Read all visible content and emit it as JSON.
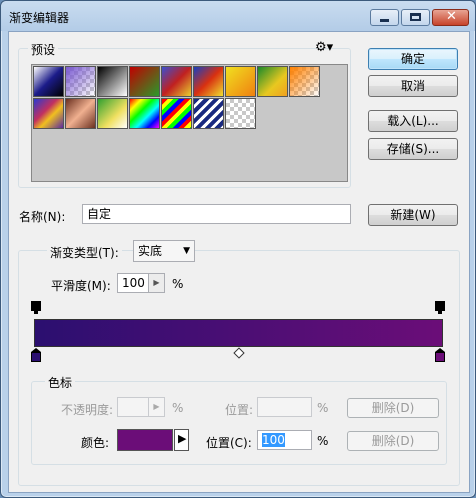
{
  "window": {
    "title": "渐变编辑器"
  },
  "presets": {
    "label": "预设",
    "menu_icon": "gear-icon",
    "swatches": [
      {
        "bg": "linear-gradient(135deg,#ffffff,#1c1c8a 50%,#000000)",
        "checker": false
      },
      {
        "bg": "linear-gradient(135deg,#7a5ad0,rgba(122,90,208,0))",
        "checker": true
      },
      {
        "bg": "linear-gradient(135deg,#000,#fff)",
        "checker": false
      },
      {
        "bg": "linear-gradient(135deg,#c00000,#2a9a2a)",
        "checker": false
      },
      {
        "bg": "linear-gradient(135deg,#3a50d0,#c02020 50%,#e8d030)",
        "checker": false
      },
      {
        "bg": "linear-gradient(135deg,#1840c0,#d83010 50%,#f0e030)",
        "checker": false
      },
      {
        "bg": "linear-gradient(135deg,#f0e020,#f08010)",
        "checker": false
      },
      {
        "bg": "linear-gradient(135deg,#1a8a2a,#e8c820 60%,#f0a020)",
        "checker": false
      },
      {
        "bg": "linear-gradient(135deg,#ff8000,rgba(255,128,0,0))",
        "checker": true
      },
      {
        "bg": "linear-gradient(135deg,#2a3ad0,#c23060 40%,#f0c020 60%,#5a2aa0)",
        "checker": false
      },
      {
        "bg": "linear-gradient(135deg,#6a3020,#f0b090 50%,#6a3020)",
        "checker": false
      },
      {
        "bg": "linear-gradient(135deg,#30a030,#f0e060 60%,#ffffff)",
        "checker": false
      },
      {
        "bg": "linear-gradient(135deg,#ff0000,#ffff00 20%,#00ff00 40%,#00ffff 60%,#0000ff 80%,#ff00ff)",
        "checker": false
      },
      {
        "bg": "repeating-linear-gradient(135deg,#ff0000 0 4px,#ffff00 4px 8px,#00ff00 8px 12px,#0000ff 12px 16px)",
        "checker": false
      },
      {
        "bg": "repeating-linear-gradient(135deg,#1a2a80 0 4px,#ffffff 4px 7px)",
        "checker": false
      },
      {
        "bg": "transparent",
        "checker": true
      }
    ]
  },
  "buttons": {
    "ok": "确定",
    "cancel": "取消",
    "load": "载入(L)...",
    "save": "存储(S)...",
    "new": "新建(W)"
  },
  "name": {
    "label": "名称(N):",
    "value": "自定"
  },
  "gradient_type": {
    "label": "渐变类型(T):",
    "value": "实底"
  },
  "smoothness": {
    "label": "平滑度(M):",
    "value": "100",
    "unit": "%"
  },
  "gradient": {
    "color_start": "#2b0f70",
    "color_end": "#6b0d78"
  },
  "color_stops": {
    "label": "色标",
    "opacity_label": "不透明度:",
    "opacity_unit": "%",
    "opacity_location_label": "位置:",
    "opacity_location_unit": "%",
    "opacity_delete": "删除(D)",
    "color_label": "颜色:",
    "color_value": "#6b0d78",
    "location_label": "位置(C):",
    "location_value": "100",
    "location_unit": "%",
    "color_delete": "删除(D)"
  }
}
